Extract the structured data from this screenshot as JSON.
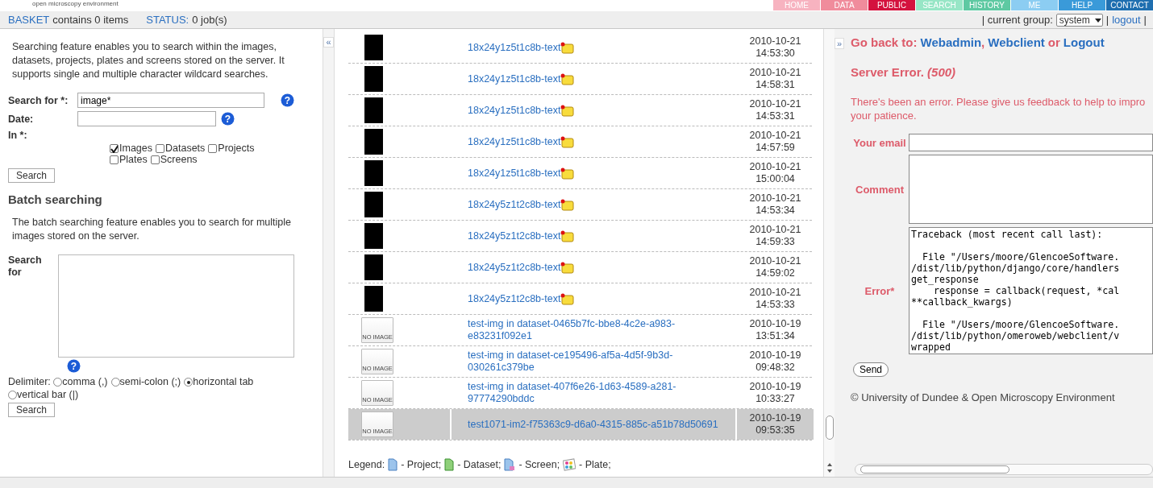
{
  "brand": {
    "tagline": "open microscopy environment"
  },
  "nav_tabs": [
    {
      "label": "HOME",
      "color": "#f7b3c0"
    },
    {
      "label": "DATA",
      "color": "#f08c9c"
    },
    {
      "label": "PUBLIC",
      "color": "#d4123e"
    },
    {
      "label": "SEARCH",
      "color": "#97e6c6"
    },
    {
      "label": "HISTORY",
      "color": "#5ec9a2"
    },
    {
      "label": "ME",
      "color": "#8ccdf2"
    },
    {
      "label": "HELP",
      "color": "#3a9ad9"
    },
    {
      "label": "CONTACT",
      "color": "#1f6fb0"
    }
  ],
  "status_bar": {
    "basket_link": "BASKET",
    "basket_text": "contains 0 items",
    "status_link": "STATUS:",
    "status_text": "0 job(s)",
    "group_label": "| current group:",
    "group_value": "system",
    "separator": "|",
    "logout": "logout",
    "end_separator": "|"
  },
  "search_panel": {
    "intro": "Searching feature enables you to search within the images, datasets, projects, plates and screens stored on the server. It supports single and multiple character wildcard searches.",
    "help_mark": "?",
    "search_label": "Search for *:",
    "search_value": "image*",
    "date_label": "Date:",
    "in_label": "In *:",
    "types": [
      {
        "label": "Images",
        "checked": true
      },
      {
        "label": "Datasets",
        "checked": false
      },
      {
        "label": "Projects",
        "checked": false
      },
      {
        "label": "Plates",
        "checked": false
      },
      {
        "label": "Screens",
        "checked": false
      }
    ],
    "search_button": "Search",
    "batch_title": "Batch searching",
    "batch_intro": "The batch searching feature enables you to search for multiple images stored on the server.",
    "batch_label": "Search for",
    "delimiter_label": "Delimiter:",
    "delimiters": [
      {
        "label": "comma (,)",
        "selected": false
      },
      {
        "label": "semi-colon (;)",
        "selected": false
      },
      {
        "label": "horizontal tab",
        "selected": true
      },
      {
        "label": "vertical bar (|)",
        "selected": false
      }
    ],
    "batch_button": "Search"
  },
  "left_toggle": "«",
  "results": {
    "rows": [
      {
        "kind": "thumbnail",
        "name": "18x24y1z5t1c8b-text",
        "annotated": true,
        "date": "2010-10-21",
        "time": "14:53:30",
        "selected": false
      },
      {
        "kind": "thumbnail",
        "name": "18x24y1z5t1c8b-text",
        "annotated": true,
        "date": "2010-10-21",
        "time": "14:58:31",
        "selected": false
      },
      {
        "kind": "thumbnail",
        "name": "18x24y1z5t1c8b-text",
        "annotated": true,
        "date": "2010-10-21",
        "time": "14:53:31",
        "selected": false
      },
      {
        "kind": "thumbnail",
        "name": "18x24y1z5t1c8b-text",
        "annotated": true,
        "date": "2010-10-21",
        "time": "14:57:59",
        "selected": false
      },
      {
        "kind": "thumbnail",
        "name": "18x24y1z5t1c8b-text",
        "annotated": true,
        "date": "2010-10-21",
        "time": "15:00:04",
        "selected": false
      },
      {
        "kind": "thumbnail",
        "name": "18x24y5z1t2c8b-text",
        "annotated": true,
        "date": "2010-10-21",
        "time": "14:53:34",
        "selected": false
      },
      {
        "kind": "thumbnail",
        "name": "18x24y5z1t2c8b-text",
        "annotated": true,
        "date": "2010-10-21",
        "time": "14:59:33",
        "selected": false
      },
      {
        "kind": "thumbnail",
        "name": "18x24y5z1t2c8b-text",
        "annotated": true,
        "date": "2010-10-21",
        "time": "14:59:02",
        "selected": false
      },
      {
        "kind": "thumbnail",
        "name": "18x24y5z1t2c8b-text",
        "annotated": true,
        "date": "2010-10-21",
        "time": "14:53:33",
        "selected": false
      },
      {
        "kind": "no_image",
        "no_image": "NO IMAGE",
        "name": "test-img in dataset-0465b7fc-bbe8-4c2e-a983-e83231f092e1",
        "annotated": false,
        "date": "2010-10-19",
        "time": "13:51:34",
        "selected": false
      },
      {
        "kind": "no_image",
        "no_image": "NO IMAGE",
        "name": "test-img in dataset-ce195496-af5a-4d5f-9b3d-030261c379be",
        "annotated": false,
        "date": "2010-10-19",
        "time": "09:48:32",
        "selected": false
      },
      {
        "kind": "no_image",
        "no_image": "NO IMAGE",
        "name": "test-img in dataset-407f6e26-1d63-4589-a281-97774290bddc",
        "annotated": false,
        "date": "2010-10-19",
        "time": "10:33:27",
        "selected": false
      },
      {
        "kind": "no_image",
        "no_image": "NO IMAGE",
        "name": "test1071-im2-f75363c9-d6a0-4315-885c-a51b78d50691",
        "annotated": false,
        "date": "2010-10-19",
        "time": "09:53:35",
        "selected": true
      }
    ],
    "legend_label": "Legend:",
    "legend": [
      {
        "kind": "project",
        "label": "- Project;"
      },
      {
        "kind": "dataset",
        "label": "- Dataset;"
      },
      {
        "kind": "screen",
        "label": "- Screen;"
      },
      {
        "kind": "plate",
        "label": "- Plate;"
      }
    ]
  },
  "right_toggle": "»",
  "error_panel": {
    "go_back": "Go back to:",
    "links": [
      {
        "label": "Webadmin",
        "after": ","
      },
      {
        "label": "Webclient",
        "after": "or"
      },
      {
        "label": "Logout"
      }
    ],
    "title": "Server Error.",
    "code": "(500)",
    "message": "There's been an error. Please give us feedback to help to impro\nyour patience.",
    "email_label": "Your email",
    "comment_label": "Comment",
    "error_label": "Error*",
    "traceback": "Traceback (most recent call last):\n\n  File \"/Users/moore/GlencoeSoftware.\n/dist/lib/python/django/core/handlers\nget_response\n    response = callback(request, *cal\n**callback_kwargs)\n\n  File \"/Users/moore/GlencoeSoftware.\n/dist/lib/python/omeroweb/webclient/v\nwrapped",
    "send_button": "Send",
    "copyright": "© University of Dundee & Open Microscopy Environment"
  }
}
